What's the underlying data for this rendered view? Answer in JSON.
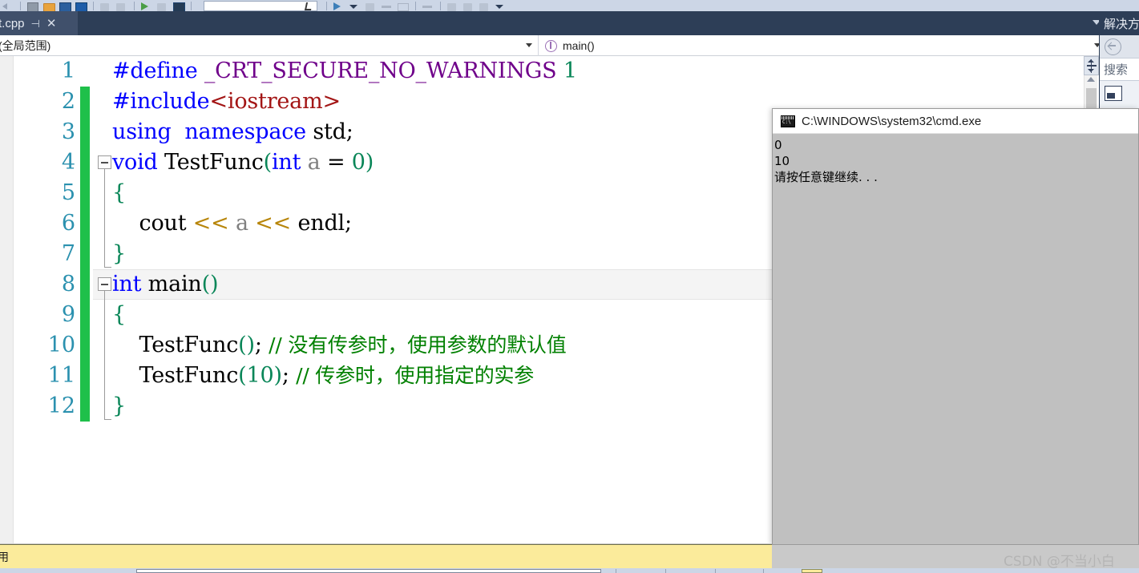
{
  "toolbar": {
    "icons": [
      "back-arrow-icon",
      "forward-arrow-icon",
      "save-icon",
      "open-folder-icon",
      "window-blue-icon",
      "window-blue-alt-icon",
      "undo-icon",
      "redo-icon",
      "build-icon",
      "debug-icon",
      "play-icon",
      "dropdown-caret-icon",
      "layout-icon",
      "grid-icon"
    ],
    "config_combo_value": "",
    "label_attach": ""
  },
  "tab": {
    "title": "t.cpp",
    "pin_icon": "⊣",
    "close_icon": "✕"
  },
  "navbar": {
    "scope": "(全局范围)",
    "member": "main()"
  },
  "editor": {
    "lines": [
      {
        "n": "1",
        "changed": false,
        "fold": false,
        "highlight": false,
        "tokens": [
          {
            "t": "#define ",
            "c": "pp"
          },
          {
            "t": "_CRT_SECURE_NO_WARNINGS ",
            "c": "mac"
          },
          {
            "t": "1",
            "c": "num"
          }
        ]
      },
      {
        "n": "2",
        "changed": true,
        "fold": false,
        "highlight": false,
        "tokens": [
          {
            "t": "#include",
            "c": "pp"
          },
          {
            "t": "<iostream>",
            "c": "str"
          }
        ]
      },
      {
        "n": "3",
        "changed": true,
        "fold": false,
        "highlight": false,
        "tokens": [
          {
            "t": "using  namespace ",
            "c": "k"
          },
          {
            "t": "std;",
            "c": "id"
          }
        ]
      },
      {
        "n": "4",
        "changed": true,
        "fold": true,
        "highlight": false,
        "tokens": [
          {
            "t": "void ",
            "c": "k"
          },
          {
            "t": "TestFunc",
            "c": "id"
          },
          {
            "t": "(",
            "c": "brk1"
          },
          {
            "t": "int ",
            "c": "k"
          },
          {
            "t": "a ",
            "c": "var"
          },
          {
            "t": "= ",
            "c": "op"
          },
          {
            "t": "0",
            "c": "num"
          },
          {
            "t": ")",
            "c": "brk1"
          }
        ]
      },
      {
        "n": "5",
        "changed": true,
        "fold": false,
        "highlight": false,
        "tokens": [
          {
            "t": "{",
            "c": "brk1"
          }
        ]
      },
      {
        "n": "6",
        "changed": true,
        "fold": false,
        "highlight": false,
        "tokens": [
          {
            "t": "    cout ",
            "c": "id"
          },
          {
            "t": "<< ",
            "c": "brk2"
          },
          {
            "t": "a ",
            "c": "var"
          },
          {
            "t": "<< ",
            "c": "brk2"
          },
          {
            "t": "endl;",
            "c": "id"
          }
        ]
      },
      {
        "n": "7",
        "changed": true,
        "fold": false,
        "highlight": false,
        "tokens": [
          {
            "t": "}",
            "c": "brk1"
          }
        ]
      },
      {
        "n": "8",
        "changed": true,
        "fold": true,
        "highlight": true,
        "tokens": [
          {
            "t": "int ",
            "c": "k"
          },
          {
            "t": "main",
            "c": "id"
          },
          {
            "t": "()",
            "c": "brk1"
          }
        ]
      },
      {
        "n": "9",
        "changed": true,
        "fold": false,
        "highlight": false,
        "tokens": [
          {
            "t": "{",
            "c": "brk1"
          }
        ]
      },
      {
        "n": "10",
        "changed": true,
        "fold": false,
        "highlight": false,
        "tokens": [
          {
            "t": "    TestFunc",
            "c": "id"
          },
          {
            "t": "()",
            "c": "brk1"
          },
          {
            "t": "; ",
            "c": "id"
          },
          {
            "t": "// 没有传参时，使用参数的默认值",
            "c": "cmt"
          }
        ]
      },
      {
        "n": "11",
        "changed": true,
        "fold": false,
        "highlight": false,
        "tokens": [
          {
            "t": "    TestFunc",
            "c": "id"
          },
          {
            "t": "(",
            "c": "brk1"
          },
          {
            "t": "10",
            "c": "num"
          },
          {
            "t": ")",
            "c": "brk1"
          },
          {
            "t": "; ",
            "c": "id"
          },
          {
            "t": "// 传参时，使用指定的实参",
            "c": "cmt"
          }
        ]
      },
      {
        "n": "12",
        "changed": true,
        "fold": false,
        "highlight": false,
        "tokens": [
          {
            "t": "}",
            "c": "brk1"
          }
        ]
      }
    ]
  },
  "solution_explorer": {
    "title": "解决方",
    "back_icon": "back-navigation-icon",
    "search_placeholder": "搜索",
    "solution_icon": "solution-icon"
  },
  "console": {
    "title": "C:\\WINDOWS\\system32\\cmd.exe",
    "icon": "cmd-console-icon",
    "output": [
      "0",
      "10",
      "请按任意键继续. . ."
    ]
  },
  "yellow_bar": {
    "text": "用"
  },
  "watermark": {
    "text": "CSDN @不当小白"
  },
  "colors": {
    "vs_dark_chrome": "#2d3e57",
    "tab_active": "#40506b",
    "toolbar_bg": "#ccd6e6",
    "change_bar_green": "#1fc04a",
    "line_number": "#2b91af",
    "keyword_blue": "#0000ff",
    "macro_purple": "#6f008a",
    "number_green": "#098658",
    "comment_green": "#008000",
    "include_red": "#a31515",
    "console_bg": "#c0c0c0",
    "yellow_bar": "#fbeb9b"
  }
}
